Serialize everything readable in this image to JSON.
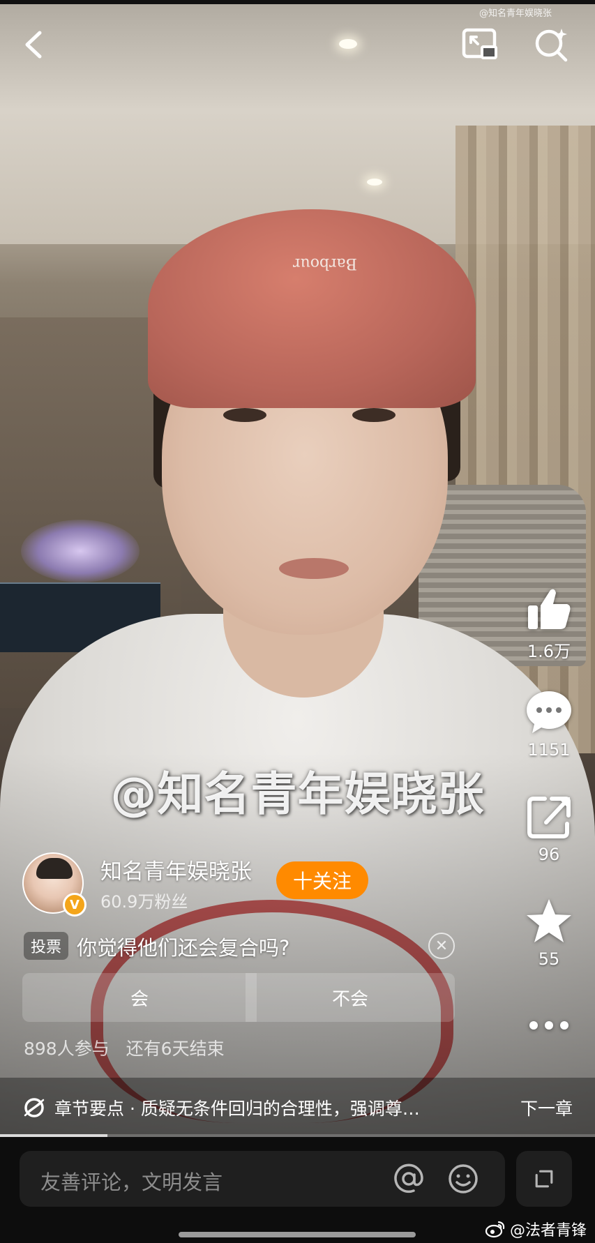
{
  "watermark_top": "@知名青年娱晓张",
  "caption": "@知名青年娱晓张",
  "top_bar": {
    "back_icon": "chevron-left-icon",
    "pip_icon": "picture-in-picture-icon",
    "search_icon": "search-icon"
  },
  "actions": [
    {
      "icon": "thumbs-up-icon",
      "count": "1.6万"
    },
    {
      "icon": "comment-icon",
      "count": "1151"
    },
    {
      "icon": "share-icon",
      "count": "96"
    },
    {
      "icon": "star-icon",
      "count": "55"
    }
  ],
  "author": {
    "name": "知名青年娱晓张",
    "fans": "60.9万粉丝",
    "badge": "V",
    "follow_label": "十关注"
  },
  "poll": {
    "tag": "投票",
    "question": "你觉得他们还会复合吗?",
    "options": [
      "会",
      "不会"
    ],
    "participants": "898人参与",
    "deadline": "还有6天结束"
  },
  "chapter": {
    "text": "章节要点 · 质疑无条件回归的合理性，强调尊…",
    "next_label": "下一章",
    "progress": 0.18
  },
  "comment": {
    "placeholder": "友善评论，文明发言"
  },
  "weibo_watermark": "@法者青锋",
  "colors": {
    "follow": "#ff8a00",
    "badge": "#f4a51a",
    "bottom_bg": "#0d0d0d"
  }
}
